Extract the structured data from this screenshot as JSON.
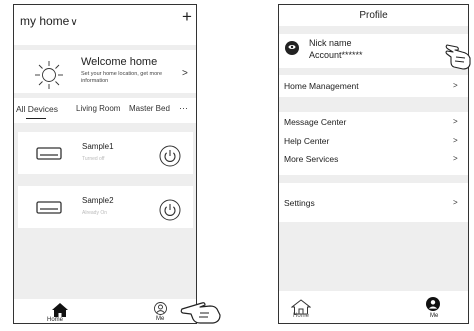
{
  "left_screen": {
    "header": {
      "title": "my home",
      "chevron": "∨",
      "add_symbol": "+"
    },
    "welcome": {
      "icon": "sun-icon",
      "title": "Welcome home",
      "subtitle": "Set your home location, get more information",
      "arrow": ">"
    },
    "tabs": {
      "items": [
        "All Devices",
        "Living Room",
        "Master Bed"
      ],
      "selected": "All Devices",
      "more": "···"
    },
    "devices": [
      {
        "name": "Sample1",
        "status": "Turned off",
        "icon": "air-conditioner-icon",
        "power_icon": "power-icon"
      },
      {
        "name": "Sample2",
        "status": "Already On",
        "icon": "air-conditioner-icon",
        "power_icon": "power-icon"
      }
    ],
    "bottom_nav": {
      "home_label": "Home",
      "me_label": "Me"
    }
  },
  "right_screen": {
    "title": "Profile",
    "profile": {
      "nick_name": "Nick name",
      "account": "Account******",
      "arrow": ">"
    },
    "menu": {
      "home_management": "Home Management",
      "message_center": "Message Center",
      "help_center": "Help Center",
      "more_services": "More Services",
      "settings": "Settings",
      "arrow": ">"
    },
    "bottom_nav": {
      "home_label": "Home",
      "me_label": "Me"
    }
  },
  "colors": {
    "background_gray": "#eeeeee",
    "status_text": "#bbbbbb",
    "outline": "#333333"
  }
}
